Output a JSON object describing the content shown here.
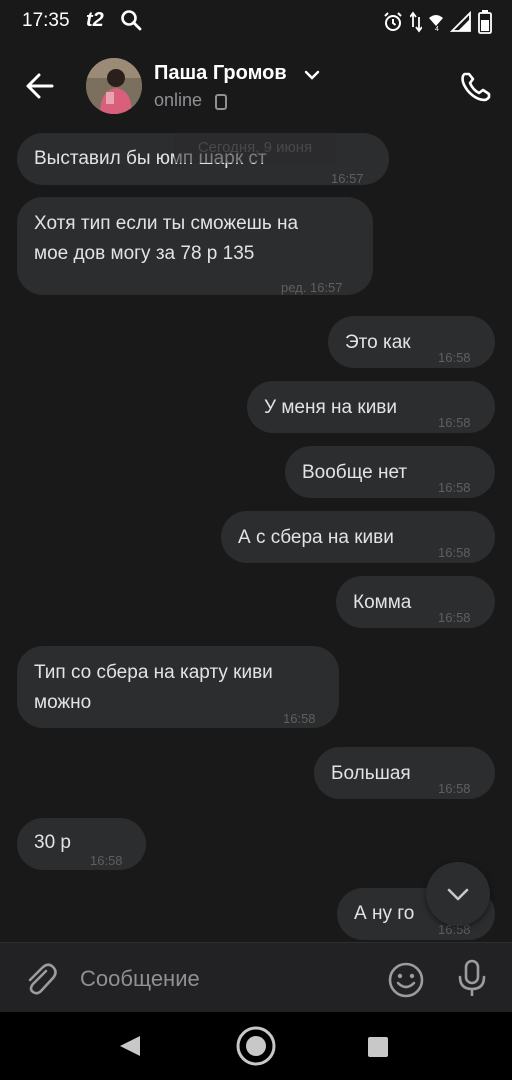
{
  "status_bar": {
    "time": "17:35",
    "carrier": "t2"
  },
  "header": {
    "contact_name": "Паша Громов",
    "status": "online"
  },
  "date_separator": "Сегодня, 9 июня",
  "messages": [
    {
      "direction": "in",
      "text": "Выставил бы юмп шарк ст",
      "time": "16:57"
    },
    {
      "direction": "in",
      "text": "Хотя тип если ты сможешь на\nмое дов могу за 78 р 135",
      "time": "ред. 16:57"
    },
    {
      "direction": "out",
      "text": "Это как",
      "time": "16:58"
    },
    {
      "direction": "out",
      "text": "У меня на киви",
      "time": "16:58"
    },
    {
      "direction": "out",
      "text": "Вообще нет",
      "time": "16:58"
    },
    {
      "direction": "out",
      "text": "А с сбера на киви",
      "time": "16:58"
    },
    {
      "direction": "out",
      "text": "Комма",
      "time": "16:58"
    },
    {
      "direction": "in",
      "text": "Тип со сбера на карту киви\nможно",
      "time": "16:58"
    },
    {
      "direction": "out",
      "text": "Большая",
      "time": "16:58"
    },
    {
      "direction": "in",
      "text": "30 р",
      "time": "16:58"
    },
    {
      "direction": "out",
      "text": "А ну го",
      "time": "16:58"
    }
  ],
  "composer": {
    "placeholder": "Сообщение"
  },
  "icons": {
    "back": "arrow-left-icon",
    "call": "phone-icon",
    "attach": "paperclip-icon",
    "emoji": "smiley-icon",
    "voice": "microphone-icon",
    "scroll_down": "chevron-down-icon"
  },
  "colors": {
    "background": "#19191a",
    "bubble": "#2c2d2e",
    "text": "#e1e3e6",
    "secondary_text": "#8e9093"
  }
}
